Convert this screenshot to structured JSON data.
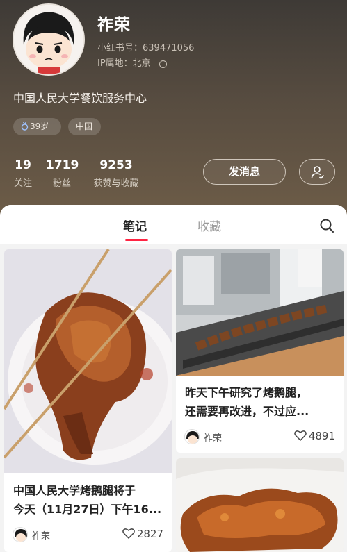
{
  "profile": {
    "name": "祚荣",
    "account_id": "小红书号：639471056",
    "ip_location": "IP属地：北京",
    "bio": "中国人民大学餐饮服务中心",
    "tags": {
      "age": "39岁",
      "region": "中国"
    }
  },
  "stats": [
    {
      "value": "19",
      "label": "关注"
    },
    {
      "value": "1719",
      "label": "粉丝"
    },
    {
      "value": "9253",
      "label": "获赞与收藏"
    }
  ],
  "actions": {
    "message_label": "发消息"
  },
  "tabs": {
    "notes": "笔记",
    "saved": "收藏"
  },
  "notes": [
    {
      "title_line1": "中国人民大学烤鹅腿将于",
      "title_line2": "今天（11月27日）下午16...",
      "author": "祚荣",
      "likes": "2827"
    },
    {
      "title_line1": "昨天下午研究了烤鹅腿，",
      "title_line2": "还需要再改进，不过应...",
      "author": "祚荣",
      "likes": "4891"
    }
  ],
  "colors": {
    "accent": "#ff2442",
    "header_bg": "#5b5044"
  },
  "icons": [
    "age-icon",
    "info-icon",
    "add-friend-icon",
    "search-icon",
    "heart-icon"
  ]
}
